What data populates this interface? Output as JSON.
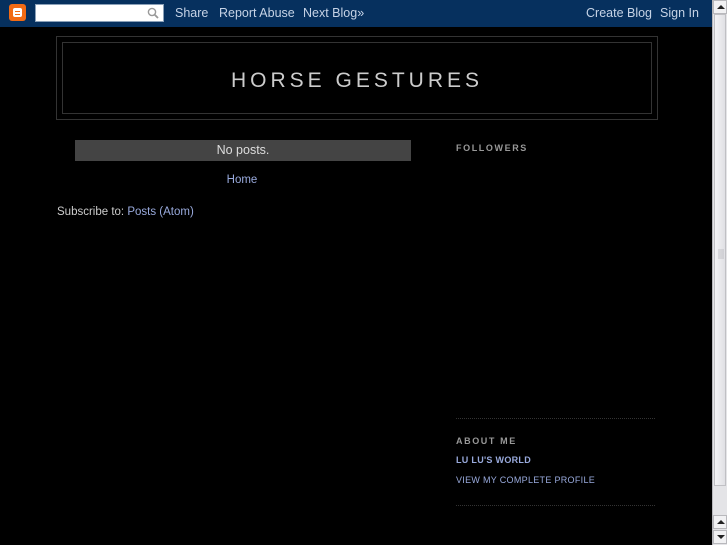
{
  "navbar": {
    "search_placeholder": "",
    "links": {
      "share": "Share",
      "report_abuse": "Report Abuse",
      "next_blog": "Next Blog»",
      "create_blog": "Create Blog",
      "sign_in": "Sign In"
    },
    "background_color": "#06305e",
    "logo_color": "#f26b14"
  },
  "header": {
    "title": "HORSE GESTURES"
  },
  "main": {
    "no_posts": "No posts.",
    "home_link": "Home",
    "subscribe_label": "Subscribe to:",
    "subscribe_link": "Posts (Atom)"
  },
  "sidebar": {
    "followers_heading": "FOLLOWERS",
    "about_heading": "ABOUT ME",
    "profile_name": "LU LU'S WORLD",
    "profile_link": "VIEW MY COMPLETE PROFILE"
  }
}
